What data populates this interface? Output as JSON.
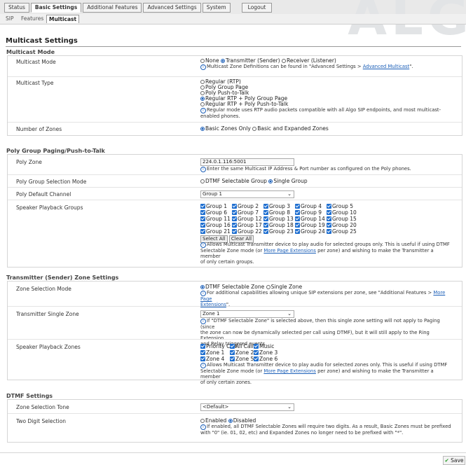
{
  "brand_watermark": "ALG",
  "tabs": [
    {
      "label": "Status"
    },
    {
      "label": "Basic Settings",
      "active": true
    },
    {
      "label": "Additional Features"
    },
    {
      "label": "Advanced Settings"
    },
    {
      "label": "System"
    },
    {
      "label": "Logout"
    }
  ],
  "subtabs": [
    {
      "label": "SIP"
    },
    {
      "label": "Features"
    },
    {
      "label": "Multicast",
      "active": true
    }
  ],
  "page_title": "Multicast Settings",
  "sections": {
    "multicast_mode": {
      "title": "Multicast Mode",
      "mode": {
        "label": "Multicast Mode",
        "options": [
          "None",
          "Transmitter (Sender)",
          "Receiver (Listener)"
        ],
        "selected": "Transmitter (Sender)",
        "help_prefix": "Multicast Zone Definitions can be found in \"Advanced Settings > ",
        "help_link": "Advanced Multicast",
        "help_suffix": "\"."
      },
      "type": {
        "label": "Multicast Type",
        "options": [
          "Regular (RTP)",
          "Poly Group Page",
          "Poly Push-to-Talk",
          "Regular RTP + Poly Group Page",
          "Regular RTP + Poly Push-to-Talk"
        ],
        "selected": "Regular RTP + Poly Group Page",
        "help_1": "Regular mode uses RTP audio packets compatible with all Algo SIP endpoints, and most multicast-",
        "help_2": "enabled phones."
      },
      "zones": {
        "label": "Number of Zones",
        "options": [
          "Basic Zones Only",
          "Basic and Expanded Zones"
        ],
        "selected": "Basic Zones Only"
      }
    },
    "poly": {
      "title": "Poly Group Paging/Push-to-Talk",
      "zone": {
        "label": "Poly Zone",
        "value": "224.0.1.116:5001",
        "help": "Enter the same Multicast IP Address & Port number as configured on the Poly phones."
      },
      "group_mode": {
        "label": "Poly Group Selection Mode",
        "options": [
          "DTMF Selectable Group",
          "Single Group"
        ],
        "selected": "Single Group"
      },
      "default_channel": {
        "label": "Poly Default Channel",
        "value": "Group 1"
      },
      "playback_groups": {
        "label": "Speaker Playback Groups",
        "rows": [
          [
            "Group 1",
            "Group 2",
            "Group 3",
            "Group 4",
            "Group 5"
          ],
          [
            "Group 6",
            "Group 7",
            "Group 8",
            "Group 9",
            "Group 10"
          ],
          [
            "Group 11",
            "Group 12",
            "Group 13",
            "Group 14",
            "Group 15"
          ],
          [
            "Group 16",
            "Group 17",
            "Group 18",
            "Group 19",
            "Group 20"
          ],
          [
            "Group 21",
            "Group 22",
            "Group 23",
            "Group 24",
            "Group 25"
          ]
        ],
        "select_all": "Select All",
        "clear_all": "Clear All",
        "help_1": "Allows Multicast Transmitter device to play audio for selected groups only. This is useful if using DTMF",
        "help_2a": "Selectable Zone mode (or ",
        "help_link": "More Page Extensions",
        "help_2b": " per zone) and wishing to make the Transmitter a member",
        "help_3": "of only certain groups."
      }
    },
    "transmitter": {
      "title": "Transmitter (Sender) Zone Settings",
      "selection_mode": {
        "label": "Zone Selection Mode",
        "options": [
          "DTMF Selectable Zone",
          "Single Zone"
        ],
        "selected": "DTMF Selectable Zone",
        "help_1a": "For additional capabilities allowing unique SIP extensions per zone, see \"Additional Features > ",
        "help_link_1": "More Page",
        "help_link_2": "Extensions",
        "help_2b": "\"."
      },
      "single_zone": {
        "label": "Transmitter Single Zone",
        "value": "Zone 1",
        "help_1": "If \"DTMF Selectable Zone\" is selected above, then this single zone setting will not apply to Paging (since",
        "help_2": "the zone can now be dynamically selected per call using DTMF), but it will still apply to the Ring Extension",
        "help_3": "and Relay triggered events."
      },
      "playback_zones": {
        "label": "Speaker Playback Zones",
        "rows": [
          [
            "Priority Call",
            "All Call",
            "Music"
          ],
          [
            "Zone 1",
            "Zone 2",
            "Zone 3"
          ],
          [
            "Zone 4",
            "Zone 5",
            "Zone 6"
          ]
        ],
        "help_1": "Allows Multicast Transmitter device to play audio for selected zones only. This is useful if using DTMF",
        "help_2a": "Selectable Zone mode (or ",
        "help_link": "More Page Extensions",
        "help_2b": " per zone) and wishing to make the Transmitter a member",
        "help_3": "of only certain zones."
      }
    },
    "dtmf": {
      "title": "DTMF Settings",
      "tone": {
        "label": "Zone Selection Tone",
        "value": "<Default>"
      },
      "two_digit": {
        "label": "Two Digit Selection",
        "options": [
          "Enabled",
          "Disabled"
        ],
        "selected": "Disabled",
        "help_1": "If enabled, all DTMF Selectable Zones will require two digits. As a result, Basic Zones must be prefixed",
        "help_2": "with \"0\" (ie. 01, 02, etc) and Expanded Zones no longer need to be prefixed with \"*\"."
      }
    }
  },
  "save_label": "Save",
  "colors": {
    "accent": "#1b5fb8",
    "checkbox": "#1f6fd0",
    "save_tick": "#2a9d2a"
  }
}
